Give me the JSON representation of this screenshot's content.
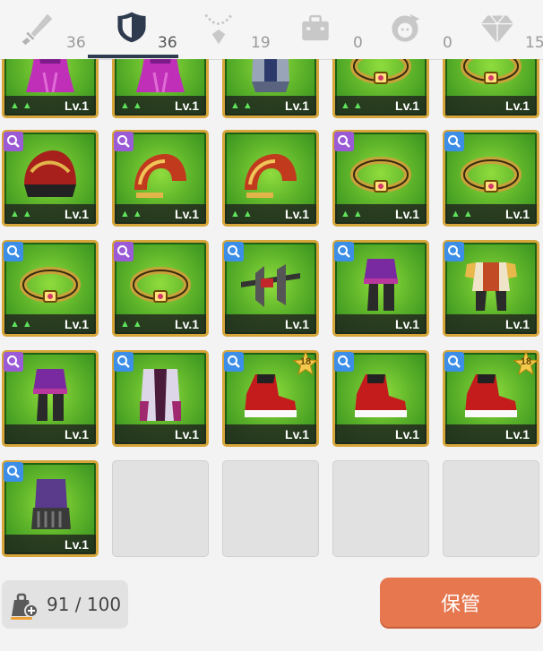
{
  "tabs": [
    {
      "name": "weapon",
      "icon": "sword-icon",
      "count": "36",
      "active": false
    },
    {
      "name": "armor",
      "icon": "shield-icon",
      "count": "36",
      "active": true
    },
    {
      "name": "accessory",
      "icon": "necklace-icon",
      "count": "19",
      "active": false
    },
    {
      "name": "bag",
      "icon": "briefcase-icon",
      "count": "0",
      "active": false
    },
    {
      "name": "pet",
      "icon": "character-icon",
      "count": "0",
      "active": false
    },
    {
      "name": "gem",
      "icon": "diamond-icon",
      "count": "15",
      "active": false
    }
  ],
  "colors": {
    "accent": "#e6774e",
    "tab_active": "#2e3a4d",
    "rare_purple": "#9b5bd6",
    "rare_blue": "#3d8ee6",
    "slot_border": "#d7a63a"
  },
  "items": [
    {
      "row": 0,
      "col": 0,
      "level": "Lv.1",
      "arrows": "▲▲",
      "icon": "dress-icon"
    },
    {
      "row": 0,
      "col": 1,
      "level": "Lv.1",
      "arrows": "▲▲",
      "icon": "dress-icon"
    },
    {
      "row": 0,
      "col": 2,
      "level": "Lv.1",
      "arrows": "▲▲",
      "icon": "armor-icon"
    },
    {
      "row": 0,
      "col": 3,
      "level": "Lv.1",
      "arrows": "▲▲",
      "icon": "belt-icon"
    },
    {
      "row": 0,
      "col": 4,
      "level": "Lv.1",
      "arrows": "",
      "icon": "belt-icon"
    },
    {
      "row": 1,
      "col": 0,
      "level": "Lv.1",
      "arrows": "▲▲",
      "badge": "purple",
      "icon": "helmet-icon"
    },
    {
      "row": 1,
      "col": 1,
      "level": "Lv.1",
      "arrows": "▲▲",
      "badge": "purple",
      "icon": "pauldron-icon"
    },
    {
      "row": 1,
      "col": 2,
      "level": "Lv.1",
      "arrows": "▲▲",
      "icon": "pauldron-icon"
    },
    {
      "row": 1,
      "col": 3,
      "level": "Lv.1",
      "arrows": "▲▲",
      "badge": "purple",
      "icon": "belt-icon"
    },
    {
      "row": 1,
      "col": 4,
      "level": "Lv.1",
      "arrows": "▲▲",
      "badge": "blue",
      "icon": "belt-icon"
    },
    {
      "row": 2,
      "col": 0,
      "level": "Lv.1",
      "arrows": "▲▲",
      "badge": "blue",
      "icon": "belt-icon"
    },
    {
      "row": 2,
      "col": 1,
      "level": "Lv.1",
      "arrows": "▲▲",
      "badge": "purple",
      "icon": "belt-icon"
    },
    {
      "row": 2,
      "col": 2,
      "level": "Lv.1",
      "arrows": "",
      "badge": "blue",
      "icon": "shoulder-guard-icon"
    },
    {
      "row": 2,
      "col": 3,
      "level": "Lv.1",
      "arrows": "",
      "badge": "blue",
      "icon": "outfit-icon"
    },
    {
      "row": 2,
      "col": 4,
      "level": "Lv.1",
      "arrows": "",
      "badge": "blue",
      "icon": "armor-suit-icon"
    },
    {
      "row": 3,
      "col": 0,
      "level": "Lv.1",
      "arrows": "",
      "badge": "purple",
      "icon": "outfit-icon"
    },
    {
      "row": 3,
      "col": 1,
      "level": "Lv.1",
      "arrows": "",
      "badge": "blue",
      "icon": "coat-icon"
    },
    {
      "row": 3,
      "col": 2,
      "level": "Lv.1",
      "arrows": "",
      "badge": "blue",
      "icon": "shoe-icon",
      "star": "18"
    },
    {
      "row": 3,
      "col": 3,
      "level": "Lv.1",
      "arrows": "",
      "badge": "blue",
      "icon": "shoe-icon"
    },
    {
      "row": 3,
      "col": 4,
      "level": "Lv.1",
      "arrows": "",
      "badge": "blue",
      "icon": "shoe-icon",
      "star": "18"
    },
    {
      "row": 4,
      "col": 0,
      "level": "Lv.1",
      "arrows": "",
      "badge": "blue",
      "icon": "gauntlet-icon"
    }
  ],
  "empty_slots": 4,
  "capacity": {
    "text": "91 / 100",
    "icon": "bag-add-icon"
  },
  "store_button": {
    "label": "保管"
  }
}
